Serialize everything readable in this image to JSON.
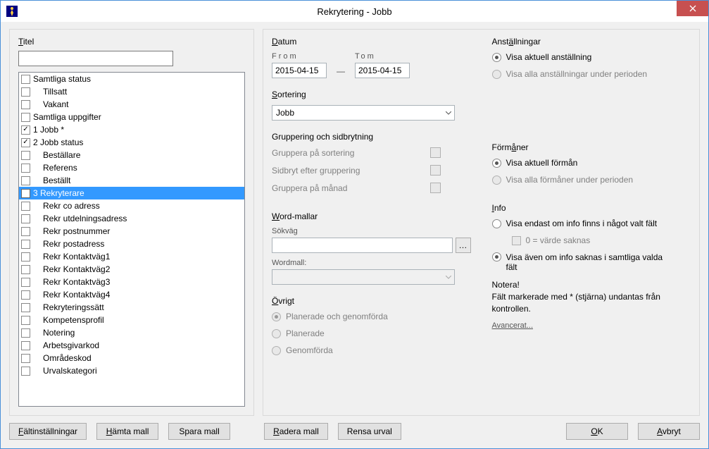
{
  "window": {
    "title": "Rekrytering - Jobb"
  },
  "left": {
    "title_label": "Titel",
    "title_value": "",
    "items": [
      {
        "label": "Samtliga status",
        "checked": false,
        "indent": 0
      },
      {
        "label": "Tillsatt",
        "checked": false,
        "indent": 1
      },
      {
        "label": "Vakant",
        "checked": false,
        "indent": 1
      },
      {
        "label": "Samtliga uppgifter",
        "checked": false,
        "indent": 0
      },
      {
        "label": "1 Jobb *",
        "checked": true,
        "indent": 0
      },
      {
        "label": "2 Jobb status",
        "checked": true,
        "indent": 0
      },
      {
        "label": "Beställare",
        "checked": false,
        "indent": 1
      },
      {
        "label": "Referens",
        "checked": false,
        "indent": 1
      },
      {
        "label": "Beställt",
        "checked": false,
        "indent": 1
      },
      {
        "label": "3 Rekryterare",
        "checked": false,
        "indent": 0,
        "selected": true
      },
      {
        "label": "Rekr co adress",
        "checked": false,
        "indent": 1
      },
      {
        "label": "Rekr utdelningsadress",
        "checked": false,
        "indent": 1
      },
      {
        "label": "Rekr postnummer",
        "checked": false,
        "indent": 1
      },
      {
        "label": "Rekr postadress",
        "checked": false,
        "indent": 1
      },
      {
        "label": "Rekr Kontaktväg1",
        "checked": false,
        "indent": 1
      },
      {
        "label": "Rekr Kontaktväg2",
        "checked": false,
        "indent": 1
      },
      {
        "label": "Rekr Kontaktväg3",
        "checked": false,
        "indent": 1
      },
      {
        "label": "Rekr Kontaktväg4",
        "checked": false,
        "indent": 1
      },
      {
        "label": "Rekryteringssätt",
        "checked": false,
        "indent": 1
      },
      {
        "label": "Kompetensprofil",
        "checked": false,
        "indent": 1
      },
      {
        "label": "Notering",
        "checked": false,
        "indent": 1
      },
      {
        "label": "Arbetsgivarkod",
        "checked": false,
        "indent": 1
      },
      {
        "label": "Områdeskod",
        "checked": false,
        "indent": 1
      },
      {
        "label": "Urvalskategori",
        "checked": false,
        "indent": 1
      }
    ]
  },
  "datum": {
    "title": "Datum",
    "from_label": "From",
    "from_value": "2015-04-15",
    "to_label": "Tom",
    "to_value": "2015-04-15"
  },
  "sortering": {
    "title": "Sortering",
    "value": "Jobb"
  },
  "gruppering": {
    "title": "Gruppering och sidbrytning",
    "opt1": "Gruppera på sortering",
    "opt2": "Sidbryt efter gruppering",
    "opt3": "Gruppera på månad"
  },
  "word": {
    "title": "Word-mallar",
    "path_label": "Sökväg",
    "template_label": "Wordmall:"
  },
  "ovrigt": {
    "title": "Övrigt",
    "r1": "Planerade och genomförda",
    "r2": "Planerade",
    "r3": "Genomförda"
  },
  "anstall": {
    "title": "Anställningar",
    "r1": "Visa aktuell anställning",
    "r2": "Visa alla anställningar under perioden"
  },
  "forman": {
    "title": "Förmåner",
    "r1": "Visa aktuell förmån",
    "r2": "Visa alla förmåner under perioden"
  },
  "info": {
    "title": "Info",
    "r1": "Visa endast om info finns i något valt fält",
    "sub": "0 = värde saknas",
    "r2": "Visa även om info saknas i samtliga valda fält",
    "note_title": "Notera!",
    "note_body": "Fält markerade med * (stjärna) undantas från kontrollen.",
    "advanced": "Avancerat..."
  },
  "buttons": {
    "falt": "Fältinställningar",
    "hamta": "Hämta mall",
    "spara": "Spara mall",
    "radera": "Radera mall",
    "rensa": "Rensa urval",
    "ok": "OK",
    "avbryt": "Avbryt"
  }
}
